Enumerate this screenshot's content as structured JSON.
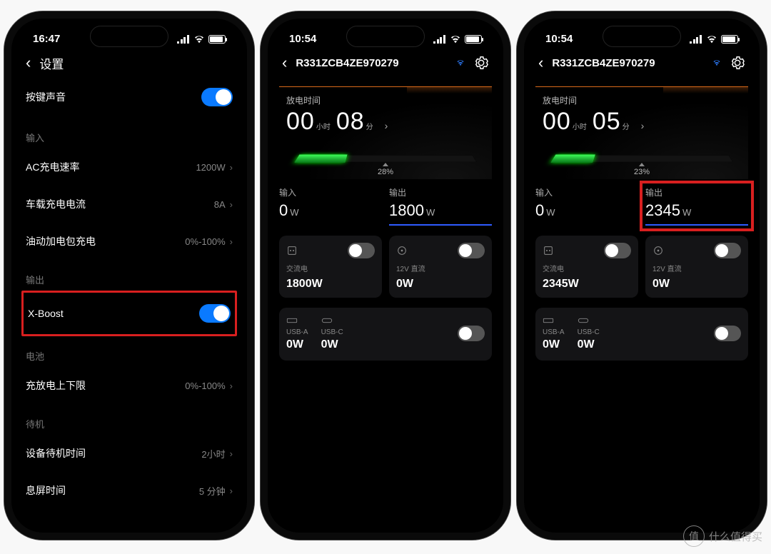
{
  "watermark": "什么值得买",
  "watermark_icon": "值",
  "phone1": {
    "time": "16:47",
    "title": "设置",
    "rows": {
      "sound": {
        "label": "按键声音",
        "on": true
      },
      "input_section": "输入",
      "ac_rate": {
        "label": "AC充电速率",
        "value": "1200W"
      },
      "car_current": {
        "label": "车载充电电流",
        "value": "8A"
      },
      "oil_charge": {
        "label": "油动加电包充电",
        "value": "0%-100%"
      },
      "output_section": "输出",
      "xboost": {
        "label": "X-Boost",
        "on": true
      },
      "battery_section": "电池",
      "limit": {
        "label": "充放电上下限",
        "value": "0%-100%"
      },
      "standby_section": "待机",
      "device_standby": {
        "label": "设备待机时间",
        "value": "2小时"
      },
      "screen_off": {
        "label": "息屏时间",
        "value": "5 分钟"
      }
    }
  },
  "phone2": {
    "time": "10:54",
    "device": "R331ZCB4ZE970279",
    "hero_label": "放电时间",
    "hours": "00",
    "h_unit": "小时",
    "mins": "08",
    "m_unit": "分",
    "pct": "28%",
    "pct_width": "28%",
    "input_label": "输入",
    "input_val": "0",
    "input_unit": "W",
    "output_label": "输出",
    "output_val": "1800",
    "output_unit": "W",
    "ac": {
      "sub": "交流电",
      "val": "1800W"
    },
    "dc": {
      "sub": "12V 直流",
      "val": "0W"
    },
    "usb_a": {
      "sub": "USB-A",
      "val": "0W"
    },
    "usb_c": {
      "sub": "USB-C",
      "val": "0W"
    }
  },
  "phone3": {
    "time": "10:54",
    "device": "R331ZCB4ZE970279",
    "hero_label": "放电时间",
    "hours": "00",
    "h_unit": "小时",
    "mins": "05",
    "m_unit": "分",
    "pct": "23%",
    "pct_width": "23%",
    "input_label": "输入",
    "input_val": "0",
    "input_unit": "W",
    "output_label": "输出",
    "output_val": "2345",
    "output_unit": "W",
    "ac": {
      "sub": "交流电",
      "val": "2345W"
    },
    "dc": {
      "sub": "12V 直流",
      "val": "0W"
    },
    "usb_a": {
      "sub": "USB-A",
      "val": "0W"
    },
    "usb_c": {
      "sub": "USB-C",
      "val": "0W"
    }
  }
}
